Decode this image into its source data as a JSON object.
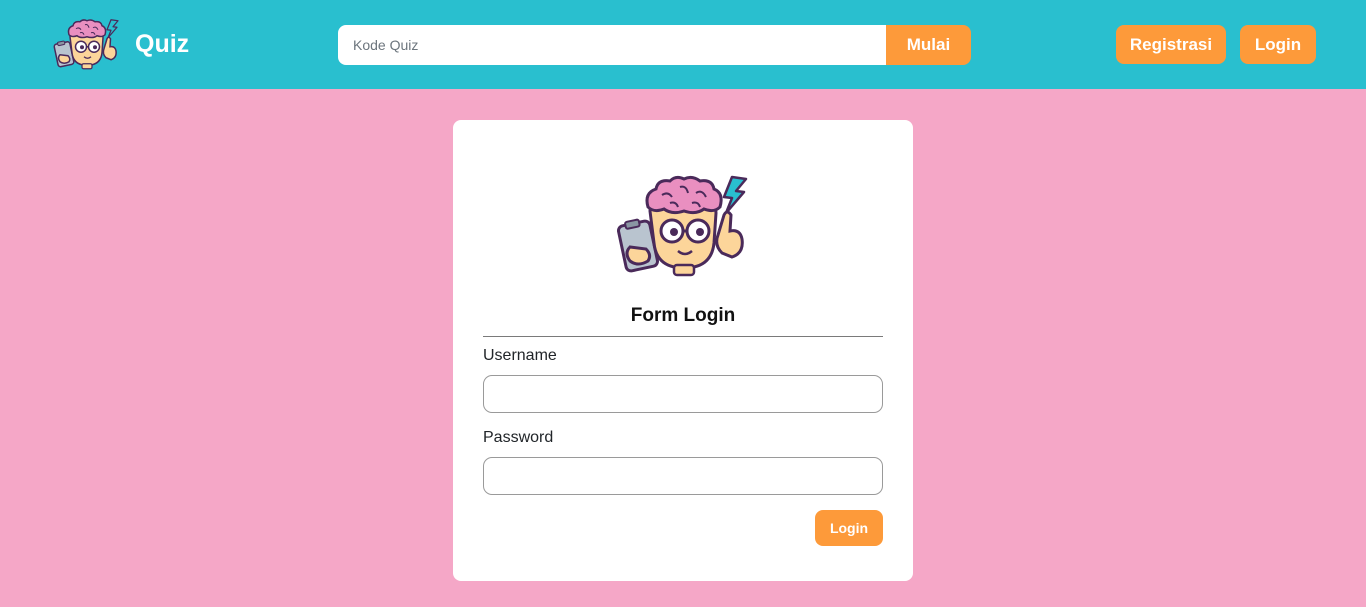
{
  "app": {
    "brand_name": "Quiz"
  },
  "colors": {
    "navbar": "#29bfcf",
    "background": "#f5a7c7",
    "accent": "#fd9a3a",
    "card": "#ffffff"
  },
  "icons": {
    "brand_logo": "brain-mascot-icon",
    "card_logo": "brain-mascot-icon"
  },
  "search": {
    "placeholder": "Kode Quiz",
    "value": "",
    "button_label": "Mulai"
  },
  "nav": {
    "register_label": "Registrasi",
    "login_label": "Login"
  },
  "form": {
    "title": "Form Login",
    "username_label": "Username",
    "username_value": "",
    "password_label": "Password",
    "password_value": "",
    "submit_label": "Login"
  }
}
